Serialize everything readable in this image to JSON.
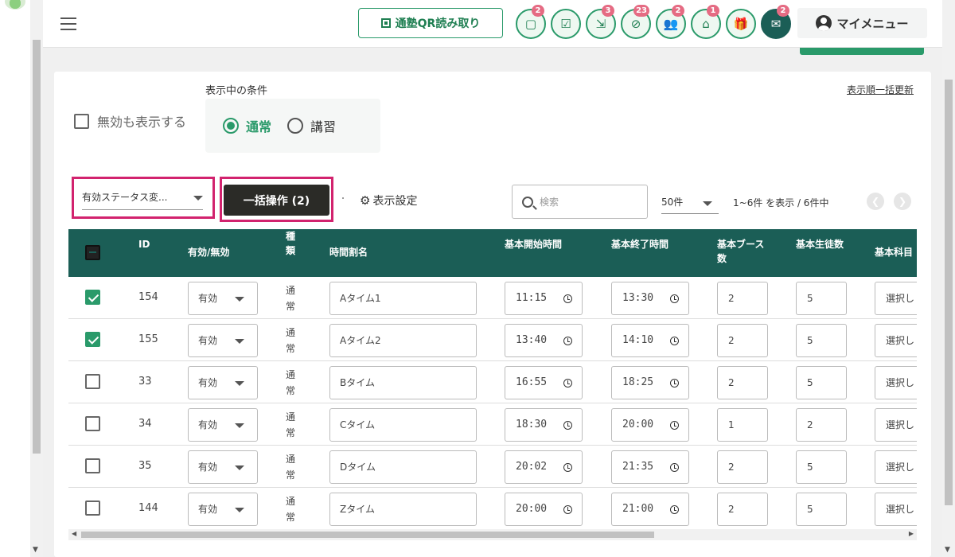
{
  "header": {
    "qr_button": "通塾QR読み取り",
    "icons": [
      {
        "name": "chat-bubble-icon",
        "glyph": "▢",
        "badge": "2"
      },
      {
        "name": "checklist-icon",
        "glyph": "☑",
        "badge": ""
      },
      {
        "name": "merge-arrows-icon",
        "glyph": "⇲",
        "badge": "3"
      },
      {
        "name": "no-camera-icon",
        "glyph": "⊘",
        "badge": "23"
      },
      {
        "name": "group-icon",
        "glyph": "👥",
        "badge": "2"
      },
      {
        "name": "bank-icon",
        "glyph": "⌂",
        "badge": "1"
      },
      {
        "name": "gift-icon",
        "glyph": "🎁",
        "badge": ""
      },
      {
        "name": "messages-icon",
        "glyph": "✉",
        "badge": "2"
      }
    ],
    "my_menu": "マイメニュー"
  },
  "filters": {
    "conditions_label": "表示中の条件",
    "bulk_sort_link": "表示順一括更新",
    "show_invalid_label": "無効も表示する",
    "radio_normal": "通常",
    "radio_course": "講習"
  },
  "toolbar": {
    "status_select_value": "有効ステータス変...",
    "bulk_button": "一括操作 (2)",
    "display_settings": "表示設定",
    "search_placeholder": "検索",
    "per_page": "50件",
    "count_text": "1~6件 を表示 / 6件中"
  },
  "table": {
    "headers": {
      "id": "ID",
      "valid": "有効/無効",
      "type": "種類",
      "name": "時間割名",
      "start": "基本開始時間",
      "end": "基本終了時間",
      "booths": "基本ブース数",
      "students": "基本生徒数",
      "subject": "基本科目"
    },
    "rows": [
      {
        "checked": true,
        "id": "154",
        "valid": "有効",
        "type": "通常",
        "name": "Aタイム1",
        "start": "11:15",
        "end": "13:30",
        "booths": "2",
        "students": "5",
        "subject": "選択し"
      },
      {
        "checked": true,
        "id": "155",
        "valid": "有効",
        "type": "通常",
        "name": "Aタイム2",
        "start": "13:40",
        "end": "14:10",
        "booths": "2",
        "students": "5",
        "subject": "選択し"
      },
      {
        "checked": false,
        "id": "33",
        "valid": "有効",
        "type": "通常",
        "name": "Bタイム",
        "start": "16:55",
        "end": "18:25",
        "booths": "2",
        "students": "5",
        "subject": "選択し"
      },
      {
        "checked": false,
        "id": "34",
        "valid": "有効",
        "type": "通常",
        "name": "Cタイム",
        "start": "18:30",
        "end": "20:00",
        "booths": "1",
        "students": "2",
        "subject": "選択し"
      },
      {
        "checked": false,
        "id": "35",
        "valid": "有効",
        "type": "通常",
        "name": "Dタイム",
        "start": "20:02",
        "end": "21:35",
        "booths": "2",
        "students": "5",
        "subject": "選択し"
      },
      {
        "checked": false,
        "id": "144",
        "valid": "有効",
        "type": "通常",
        "name": "Zタイム",
        "start": "20:00",
        "end": "21:00",
        "booths": "2",
        "students": "5",
        "subject": "選択し"
      }
    ]
  },
  "colors": {
    "brand_green": "#2a9a6a",
    "table_header": "#1b5e56",
    "highlight": "#d2236e",
    "badge": "#e56b83"
  }
}
